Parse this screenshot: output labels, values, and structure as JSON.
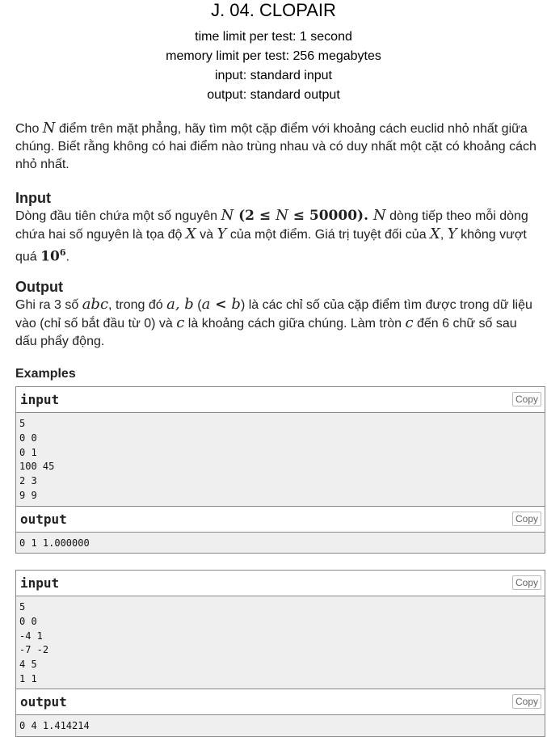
{
  "problem": {
    "title": "J. 04. CLOPAIR",
    "time_limit": "time limit per test: 1 second",
    "memory_limit": "memory limit per test: 256 megabytes",
    "input_file": "input: standard input",
    "output_file": "output: standard output"
  },
  "statement": {
    "p1_a": "Cho ",
    "p1_math": "N",
    "p1_b": " điểm trên mặt phẳng, hãy tìm một cặp điểm với khoảng cách euclid nhỏ nhất giữa chúng. Biết rằng không có hai điểm nào trùng nhau và có duy nhất một cặt có khoảng cách nhỏ nhất."
  },
  "input_section": {
    "title": "Input",
    "t1": "Dòng đầu tiên chứa một số nguyên ",
    "m1": "N",
    "m1b": " (2 ≤ ",
    "m1c": "N",
    "m1d": " ≤ 50000). ",
    "m2": "N",
    "t2": " dòng tiếp theo mỗi dòng chứa hai số nguyên là tọa độ ",
    "m3": "X",
    "t3": " và ",
    "m4": "Y",
    "t4": " của một điểm. Giá trị tuyệt đối của ",
    "m5": "X",
    "t5": ", ",
    "m6": "Y",
    "t6": " không vượt quá ",
    "m7": "10",
    "m7sup": "6",
    "t7": "."
  },
  "output_section": {
    "title": "Output",
    "t1": "Ghi ra 3 số ",
    "m1": "abc",
    "t2": ", trong đó ",
    "m2": "a, b",
    "t3": " (",
    "m3": "a",
    "t3b": " < ",
    "m3b": "b",
    "t4": ") là các chỉ số của cặp điểm tìm được trong dữ liệu vào (chỉ số bắt đầu từ 0) và ",
    "m4": "c",
    "t5": " là khoảng cách giữa chúng. Làm tròn ",
    "m5": "c",
    "t6": " đến 6 chữ số sau dấu phẩy động."
  },
  "examples": {
    "title": "Examples",
    "input_label": "input",
    "output_label": "output",
    "copy_label": "Copy",
    "ex1": {
      "input_lines": [
        "5",
        "0 0",
        "0 1",
        "100 45",
        "2 3",
        "9 9"
      ],
      "output_lines": [
        "0 1 1.000000"
      ]
    },
    "ex2": {
      "input_lines": [
        "5",
        "0 0",
        "-4 1",
        "-7 -2",
        "4 5",
        "1 1"
      ],
      "output_lines": [
        "0 4 1.414214"
      ]
    }
  }
}
